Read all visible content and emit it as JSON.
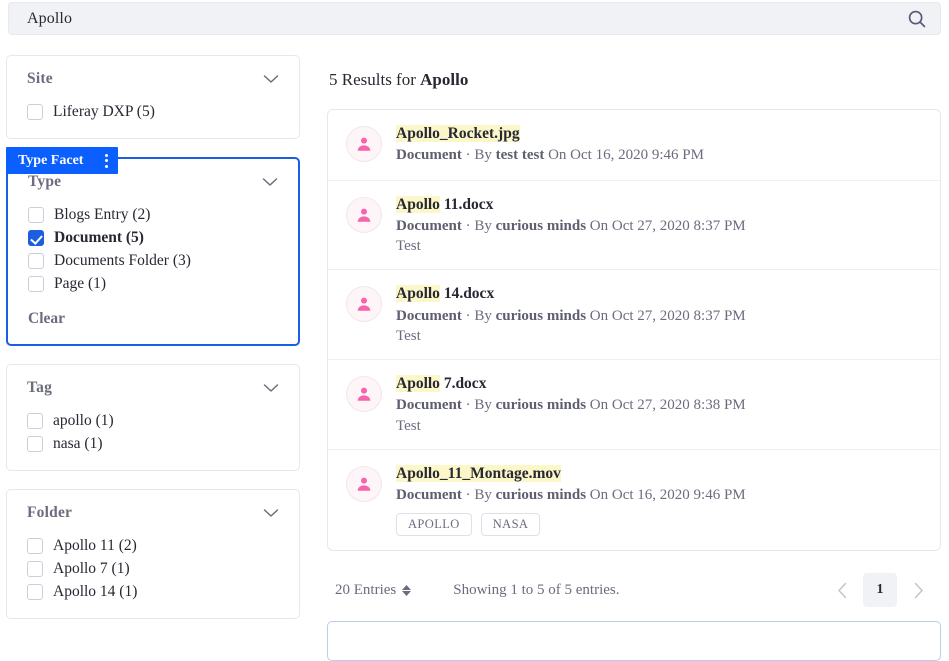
{
  "search": {
    "value": "Apollo",
    "icon": "search-icon"
  },
  "facet_badge": {
    "label": "Type Facet",
    "menu_icon": "kebab-menu-icon",
    "color": "#0b5fff"
  },
  "sidebar": {
    "facets": [
      {
        "title": "Site",
        "selected": false,
        "collapse_icon": "chevron-down-icon",
        "options": [
          {
            "label": "Liferay DXP (5)",
            "checked": false
          }
        ],
        "clear_label": null
      },
      {
        "title": "Type",
        "selected": true,
        "collapse_icon": "chevron-down-icon",
        "options": [
          {
            "label": "Blogs Entry (2)",
            "checked": false
          },
          {
            "label": "Document (5)",
            "checked": true
          },
          {
            "label": "Documents Folder (3)",
            "checked": false
          },
          {
            "label": "Page (1)",
            "checked": false
          }
        ],
        "clear_label": "Clear"
      },
      {
        "title": "Tag",
        "selected": false,
        "collapse_icon": "chevron-down-icon",
        "options": [
          {
            "label": "apollo (1)",
            "checked": false
          },
          {
            "label": "nasa (1)",
            "checked": false
          }
        ],
        "clear_label": null
      },
      {
        "title": "Folder",
        "selected": false,
        "collapse_icon": "chevron-down-icon",
        "options": [
          {
            "label": "Apollo 11 (2)",
            "checked": false
          },
          {
            "label": "Apollo 7 (1)",
            "checked": false
          },
          {
            "label": "Apollo 14 (1)",
            "checked": false
          }
        ],
        "clear_label": null
      }
    ]
  },
  "results": {
    "heading_prefix": "5 Results for ",
    "heading_term": "Apollo",
    "highlight_color": "#fbf7c9",
    "items": [
      {
        "title_highlight": "Apollo_Rocket.jpg",
        "title_rest": "",
        "type": "Document",
        "separator": " · ",
        "by_label": "By ",
        "author": "test test",
        "on_label": " On ",
        "date": "Oct 16, 2020 9:46 PM",
        "description": "",
        "tags": [],
        "avatar_icon": "user-avatar-icon"
      },
      {
        "title_highlight": "Apollo",
        "title_rest": " 11.docx",
        "type": "Document",
        "separator": " · ",
        "by_label": "By ",
        "author": "curious minds",
        "on_label": " On ",
        "date": "Oct 27, 2020 8:37 PM",
        "description": "Test",
        "tags": [],
        "avatar_icon": "user-avatar-icon"
      },
      {
        "title_highlight": "Apollo",
        "title_rest": " 14.docx",
        "type": "Document",
        "separator": " · ",
        "by_label": "By ",
        "author": "curious minds",
        "on_label": " On ",
        "date": "Oct 27, 2020 8:37 PM",
        "description": "Test",
        "tags": [],
        "avatar_icon": "user-avatar-icon"
      },
      {
        "title_highlight": "Apollo",
        "title_rest": " 7.docx",
        "type": "Document",
        "separator": " · ",
        "by_label": "By ",
        "author": "curious minds",
        "on_label": " On ",
        "date": "Oct 27, 2020 8:38 PM",
        "description": "Test",
        "tags": [],
        "avatar_icon": "user-avatar-icon"
      },
      {
        "title_highlight": "Apollo_11_Montage.mov",
        "title_rest": "",
        "type": "Document",
        "separator": " · ",
        "by_label": "By ",
        "author": "curious minds",
        "on_label": " On ",
        "date": "Oct 16, 2020 9:46 PM",
        "description": "",
        "tags": [
          "APOLLO",
          "NASA"
        ],
        "avatar_icon": "user-avatar-icon"
      }
    ]
  },
  "pagination": {
    "entries_label": "20 Entries",
    "entries_icon": "sort-updown-icon",
    "showing_text": "Showing 1 to 5 of 5 entries.",
    "prev_icon": "chevron-left-icon",
    "next_icon": "chevron-right-icon",
    "current_page": "1"
  }
}
